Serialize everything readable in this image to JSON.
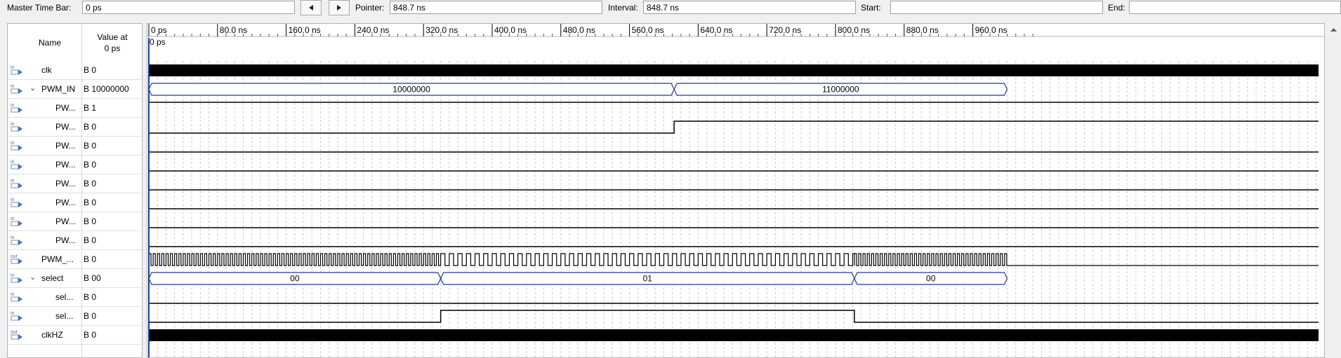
{
  "toolbar": {
    "master_label": "Master Time Bar:",
    "master_value": "0 ps",
    "pointer_label": "Pointer:",
    "pointer_value": "848.7 ns",
    "interval_label": "Interval:",
    "interval_value": "848.7 ns",
    "start_label": "Start:",
    "start_value": "",
    "end_label": "End:",
    "end_value": "",
    "prev_icon": "triangle-left-icon",
    "next_icon": "triangle-right-icon"
  },
  "header": {
    "name": "Name",
    "value_line1": "Value at",
    "value_line2": "0 ps"
  },
  "timeline": {
    "ticks": [
      "0 ps",
      "80.0 ns",
      "160.0 ns",
      "240.0 ns",
      "320.0 ns",
      "400.0 ns",
      "480.0 ns",
      "560.0 ns",
      "640.0 ns",
      "720.0 ns",
      "800.0 ns",
      "880.0 ns",
      "960.0 ns"
    ],
    "cursor_label": "0 ps"
  },
  "signals": [
    {
      "dir": "in",
      "name": "clk",
      "value": "B 0",
      "wave": "dense",
      "expand": false,
      "indent": false
    },
    {
      "dir": "in",
      "name": "PWM_IN",
      "value": "B 10000000",
      "wave": "bus",
      "expand": true,
      "indent": false,
      "segments": [
        {
          "start": 0,
          "end": 612,
          "label": "10000000"
        },
        {
          "start": 612,
          "end": 1000,
          "label": "11000000"
        }
      ]
    },
    {
      "dir": "in",
      "name": "PW...",
      "value": "B 1",
      "wave": "high",
      "expand": false,
      "indent": true
    },
    {
      "dir": "in",
      "name": "PW...",
      "value": "B 0",
      "wave": "step",
      "step_ns": 612,
      "expand": false,
      "indent": true
    },
    {
      "dir": "in",
      "name": "PW...",
      "value": "B 0",
      "wave": "low",
      "expand": false,
      "indent": true
    },
    {
      "dir": "in",
      "name": "PW...",
      "value": "B 0",
      "wave": "low",
      "expand": false,
      "indent": true
    },
    {
      "dir": "in",
      "name": "PW...",
      "value": "B 0",
      "wave": "low",
      "expand": false,
      "indent": true
    },
    {
      "dir": "in",
      "name": "PW...",
      "value": "B 0",
      "wave": "low",
      "expand": false,
      "indent": true
    },
    {
      "dir": "in",
      "name": "PW...",
      "value": "B 0",
      "wave": "low",
      "expand": false,
      "indent": true
    },
    {
      "dir": "in",
      "name": "PW...",
      "value": "B 0",
      "wave": "low",
      "expand": false,
      "indent": true
    },
    {
      "dir": "out",
      "name": "PWM_...",
      "value": "B 0",
      "wave": "pwm",
      "expand": false,
      "indent": false,
      "pwm_sections": [
        {
          "start": 0,
          "end": 340,
          "period": 5
        },
        {
          "start": 340,
          "end": 822,
          "period": 10
        },
        {
          "start": 822,
          "end": 1000,
          "period": 5
        }
      ]
    },
    {
      "dir": "in",
      "name": "select",
      "value": "B 00",
      "wave": "bus",
      "expand": true,
      "indent": false,
      "segments": [
        {
          "start": 0,
          "end": 340,
          "label": "00"
        },
        {
          "start": 340,
          "end": 822,
          "label": "01"
        },
        {
          "start": 822,
          "end": 1000,
          "label": "00"
        }
      ]
    },
    {
      "dir": "in",
      "name": "sel...",
      "value": "B 0",
      "wave": "low",
      "expand": false,
      "indent": true
    },
    {
      "dir": "in",
      "name": "sel...",
      "value": "B 0",
      "wave": "pulse",
      "pulse_start": 340,
      "pulse_end": 822,
      "expand": false,
      "indent": true
    },
    {
      "dir": "out",
      "name": "clkHZ",
      "value": "B 0",
      "wave": "dense",
      "expand": false,
      "indent": false
    }
  ],
  "colors": {
    "wave": "#000000",
    "bus": "#1f3a9a",
    "grid": "#c8c8c8",
    "cursor": "#1f3a9a",
    "icon_in": "#4a6fb5"
  }
}
